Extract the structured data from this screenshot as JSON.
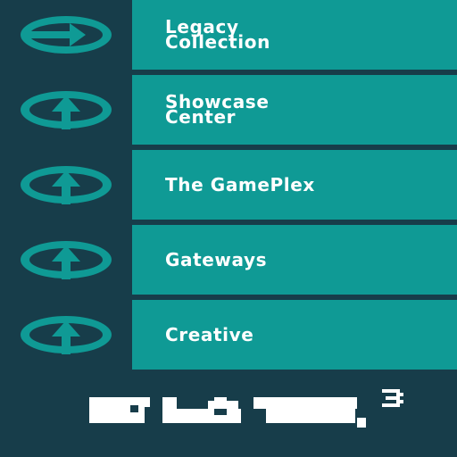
{
  "menu": {
    "items": [
      {
        "label": "Legacy\nCollection",
        "icon": "right-arrow-circle-icon",
        "selected": true
      },
      {
        "label": "Showcase\nCenter",
        "icon": "up-arrow-circle-icon",
        "selected": false
      },
      {
        "label": "The GamePlex",
        "icon": "up-arrow-circle-icon",
        "selected": false
      },
      {
        "label": "Gateways",
        "icon": "up-arrow-circle-icon",
        "selected": false
      },
      {
        "label": "Creative",
        "icon": "up-arrow-circle-icon",
        "selected": false
      }
    ]
  },
  "logo": {
    "text": "PLT3",
    "icon": "pixel-logo"
  },
  "colors": {
    "background": "#173d4a",
    "tile": "#0f9a95",
    "icon": "#0f9a95",
    "text": "#ffffff"
  }
}
